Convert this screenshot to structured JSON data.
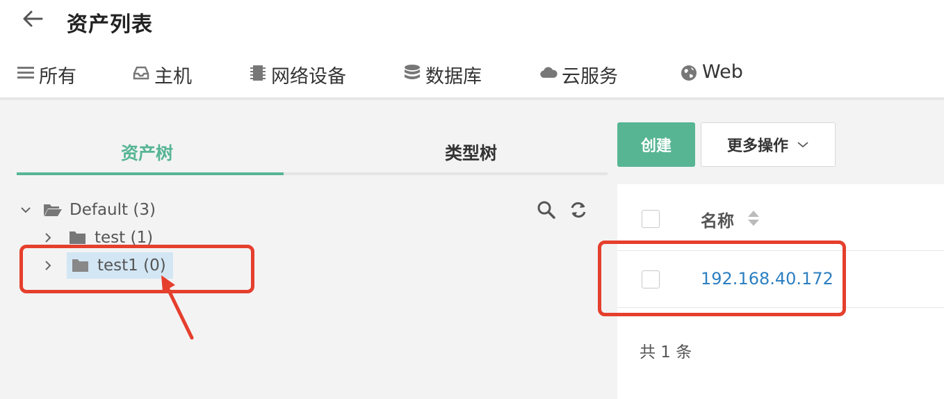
{
  "header": {
    "title": "资产列表"
  },
  "tabs": [
    {
      "label": "所有",
      "icon": "list-icon",
      "active": true
    },
    {
      "label": "主机",
      "icon": "inbox-icon"
    },
    {
      "label": "网络设备",
      "icon": "chip-icon"
    },
    {
      "label": "数据库",
      "icon": "database-icon"
    },
    {
      "label": "云服务",
      "icon": "cloud-icon"
    },
    {
      "label": "Web",
      "icon": "globe-icon"
    }
  ],
  "tree_tabs": {
    "asset_tree": "资产树",
    "type_tree": "类型树"
  },
  "tree": {
    "root": "Default (3)",
    "children": [
      {
        "label": "test (1)"
      },
      {
        "label": "test1 (0)",
        "selected": true
      }
    ]
  },
  "toolbar": {
    "create": "创建",
    "more": "更多操作"
  },
  "table": {
    "header_name": "名称",
    "rows": [
      {
        "name": "192.168.40.172"
      }
    ],
    "total": "共 1 条"
  },
  "colors": {
    "accent": "#57b594",
    "link": "#2d7fc1",
    "annotation": "#e53f2d",
    "selected_bg": "#d3e6f4"
  }
}
